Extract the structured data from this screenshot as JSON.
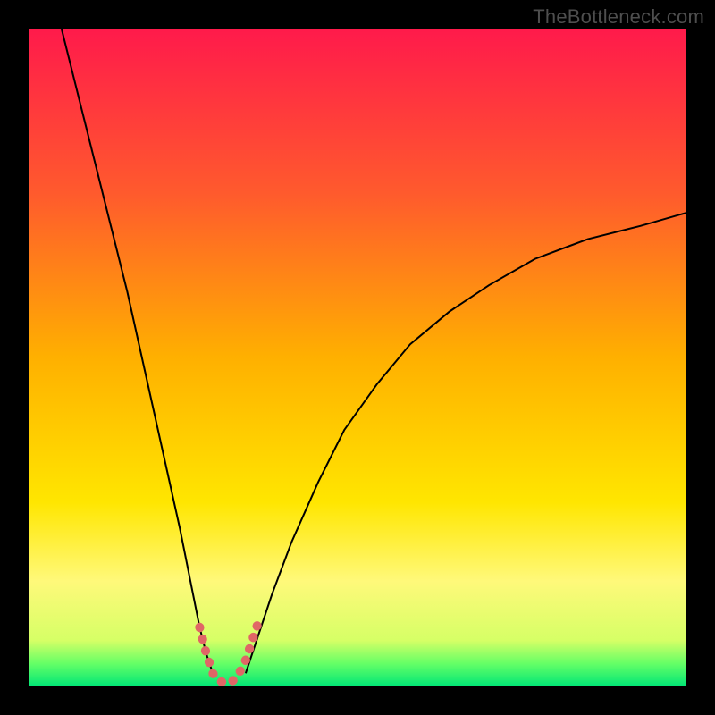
{
  "watermark": {
    "text": "TheBottleneck.com"
  },
  "chart_data": {
    "type": "line",
    "title": "",
    "xlabel": "",
    "ylabel": "",
    "xlim": [
      0,
      100
    ],
    "ylim": [
      0,
      100
    ],
    "grid": false,
    "legend": false,
    "gradient_stops": [
      {
        "offset": 0.0,
        "color": "#ff1a4b"
      },
      {
        "offset": 0.25,
        "color": "#ff5a2d"
      },
      {
        "offset": 0.5,
        "color": "#ffb000"
      },
      {
        "offset": 0.72,
        "color": "#ffe600"
      },
      {
        "offset": 0.84,
        "color": "#fff97a"
      },
      {
        "offset": 0.93,
        "color": "#d6ff66"
      },
      {
        "offset": 0.965,
        "color": "#66ff66"
      },
      {
        "offset": 1.0,
        "color": "#00e676"
      }
    ],
    "series": [
      {
        "name": "curve-left",
        "stroke": "#000000",
        "stroke_width": 2,
        "x": [
          5,
          7,
          9,
          11,
          13,
          15,
          17,
          19,
          21,
          23,
          25,
          26,
          27,
          28
        ],
        "y": [
          100,
          92,
          84,
          76,
          68,
          60,
          51,
          42,
          33,
          24,
          14,
          9,
          5,
          2
        ]
      },
      {
        "name": "curve-right",
        "stroke": "#000000",
        "stroke_width": 2,
        "x": [
          33,
          34,
          35,
          37,
          40,
          44,
          48,
          53,
          58,
          64,
          70,
          77,
          85,
          93,
          100
        ],
        "y": [
          2,
          5,
          8,
          14,
          22,
          31,
          39,
          46,
          52,
          57,
          61,
          65,
          68,
          70,
          72
        ]
      },
      {
        "name": "valley-highlight",
        "stroke": "#e06666",
        "stroke_width": 10,
        "linecap": "round",
        "x": [
          26,
          27,
          28,
          29,
          30,
          31,
          32,
          33,
          34,
          35
        ],
        "y": [
          9,
          5,
          2,
          0.8,
          0.5,
          0.8,
          2,
          4,
          7,
          10
        ]
      }
    ]
  }
}
